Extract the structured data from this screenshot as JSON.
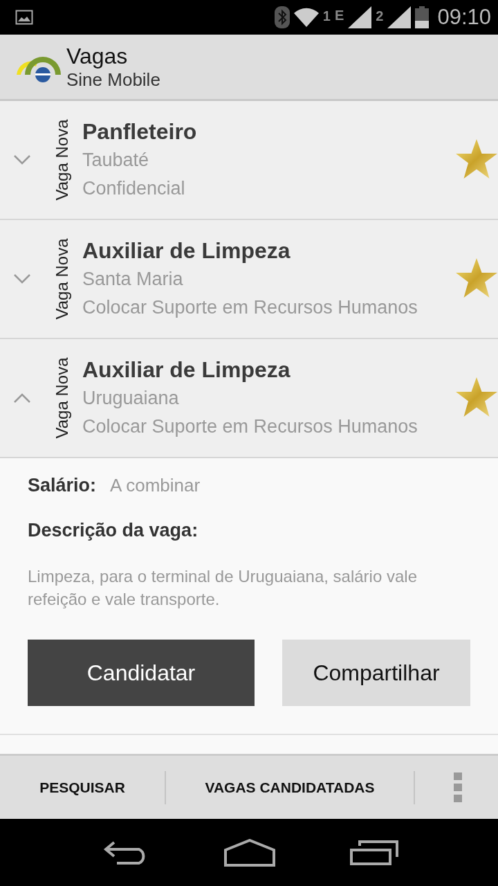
{
  "status_bar": {
    "sim1": "1",
    "network": "E",
    "sim2": "2",
    "time": "09:10"
  },
  "action_bar": {
    "title": "Vagas",
    "subtitle": "Sine Mobile"
  },
  "jobs": [
    {
      "badge": "Vaga Nova",
      "title": "Panfleteiro",
      "city": "Taubaté",
      "company": "Confidencial",
      "expanded": false,
      "starred": true
    },
    {
      "badge": "Vaga Nova",
      "title": "Auxiliar de Limpeza",
      "city": "Santa Maria",
      "company": "Colocar Suporte em Recursos Humanos",
      "expanded": false,
      "starred": true
    },
    {
      "badge": "Vaga Nova",
      "title": "Auxiliar de Limpeza",
      "city": "Uruguaiana",
      "company": "Colocar Suporte em Recursos Humanos",
      "expanded": true,
      "starred": true
    }
  ],
  "details": {
    "salary_label": "Salário:",
    "salary_value": "A combinar",
    "description_label": "Descrição da vaga:",
    "description": "Limpeza, para o terminal de Uruguaiana, salário vale refeição e vale transporte.",
    "apply_button": "Candidatar",
    "share_button": "Compartilhar"
  },
  "bottom_bar": {
    "actions": [
      "PESQUISAR",
      "VAGAS CANDIDATADAS"
    ]
  }
}
